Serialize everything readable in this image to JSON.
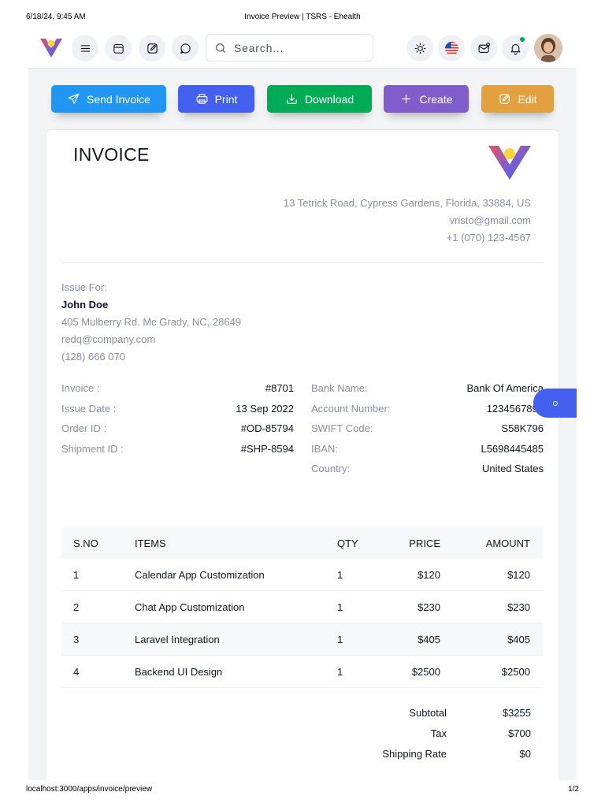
{
  "print": {
    "datetime": "6/18/24, 9:45 AM",
    "title": "Invoice Preview | TSRS - Ehealth",
    "url": "localhost:3000/apps/invoice/preview",
    "page": "1/2"
  },
  "navbar": {
    "search_placeholder": "Search...",
    "icons": [
      "menu-icon",
      "calendar-icon",
      "edit-icon",
      "chat-icon",
      "sun-icon",
      "us-flag-icon",
      "mail-icon",
      "bell-icon"
    ]
  },
  "actions": {
    "send": "Send Invoice",
    "print": "Print",
    "download": "Download",
    "create": "Create",
    "edit": "Edit"
  },
  "invoice": {
    "title": "INVOICE",
    "company": {
      "address": "13 Tetrick Road, Cypress Gardens, Florida, 33884, US",
      "email": "vristo@gmail.com",
      "phone": "+1 (070) 123-4567"
    },
    "issue_for_label": "Issue For:",
    "client": {
      "name": "John Doe",
      "address": "405 Mulberry Rd. Mc Grady, NC, 28649",
      "email": "redq@company.com",
      "phone": "(128) 666 070"
    },
    "details": [
      {
        "label": "Invoice :",
        "value": "#8701"
      },
      {
        "label": "Issue Date :",
        "value": "13 Sep 2022"
      },
      {
        "label": "Order ID :",
        "value": "#OD-85794"
      },
      {
        "label": "Shipment ID :",
        "value": "#SHP-8594"
      }
    ],
    "bank": [
      {
        "label": "Bank Name:",
        "value": "Bank Of America"
      },
      {
        "label": "Account Number:",
        "value": "1234567890"
      },
      {
        "label": "SWIFT Code:",
        "value": "S58K796"
      },
      {
        "label": "IBAN:",
        "value": "L5698445485"
      },
      {
        "label": "Country:",
        "value": "United States"
      }
    ],
    "table": {
      "headers": {
        "sno": "S.NO",
        "items": "ITEMS",
        "qty": "QTY",
        "price": "PRICE",
        "amount": "AMOUNT"
      },
      "rows": [
        {
          "sno": "1",
          "item": "Calendar App Customization",
          "qty": "1",
          "price": "$120",
          "amount": "$120"
        },
        {
          "sno": "2",
          "item": "Chat App Customization",
          "qty": "1",
          "price": "$230",
          "amount": "$230"
        },
        {
          "sno": "3",
          "item": "Laravel Integration",
          "qty": "1",
          "price": "$405",
          "amount": "$405"
        },
        {
          "sno": "4",
          "item": "Backend UI Design",
          "qty": "1",
          "price": "$2500",
          "amount": "$2500"
        }
      ]
    },
    "summary": [
      {
        "label": "Subtotal",
        "value": "$3255"
      },
      {
        "label": "Tax",
        "value": "$700"
      },
      {
        "label": "Shipping Rate",
        "value": "$0"
      }
    ]
  },
  "colors": {
    "primary": "#4361ee",
    "info": "#2196f3",
    "success": "#00ab55",
    "secondary": "#805dca",
    "warning": "#e2a03f",
    "muted_text": "#888ea8"
  }
}
